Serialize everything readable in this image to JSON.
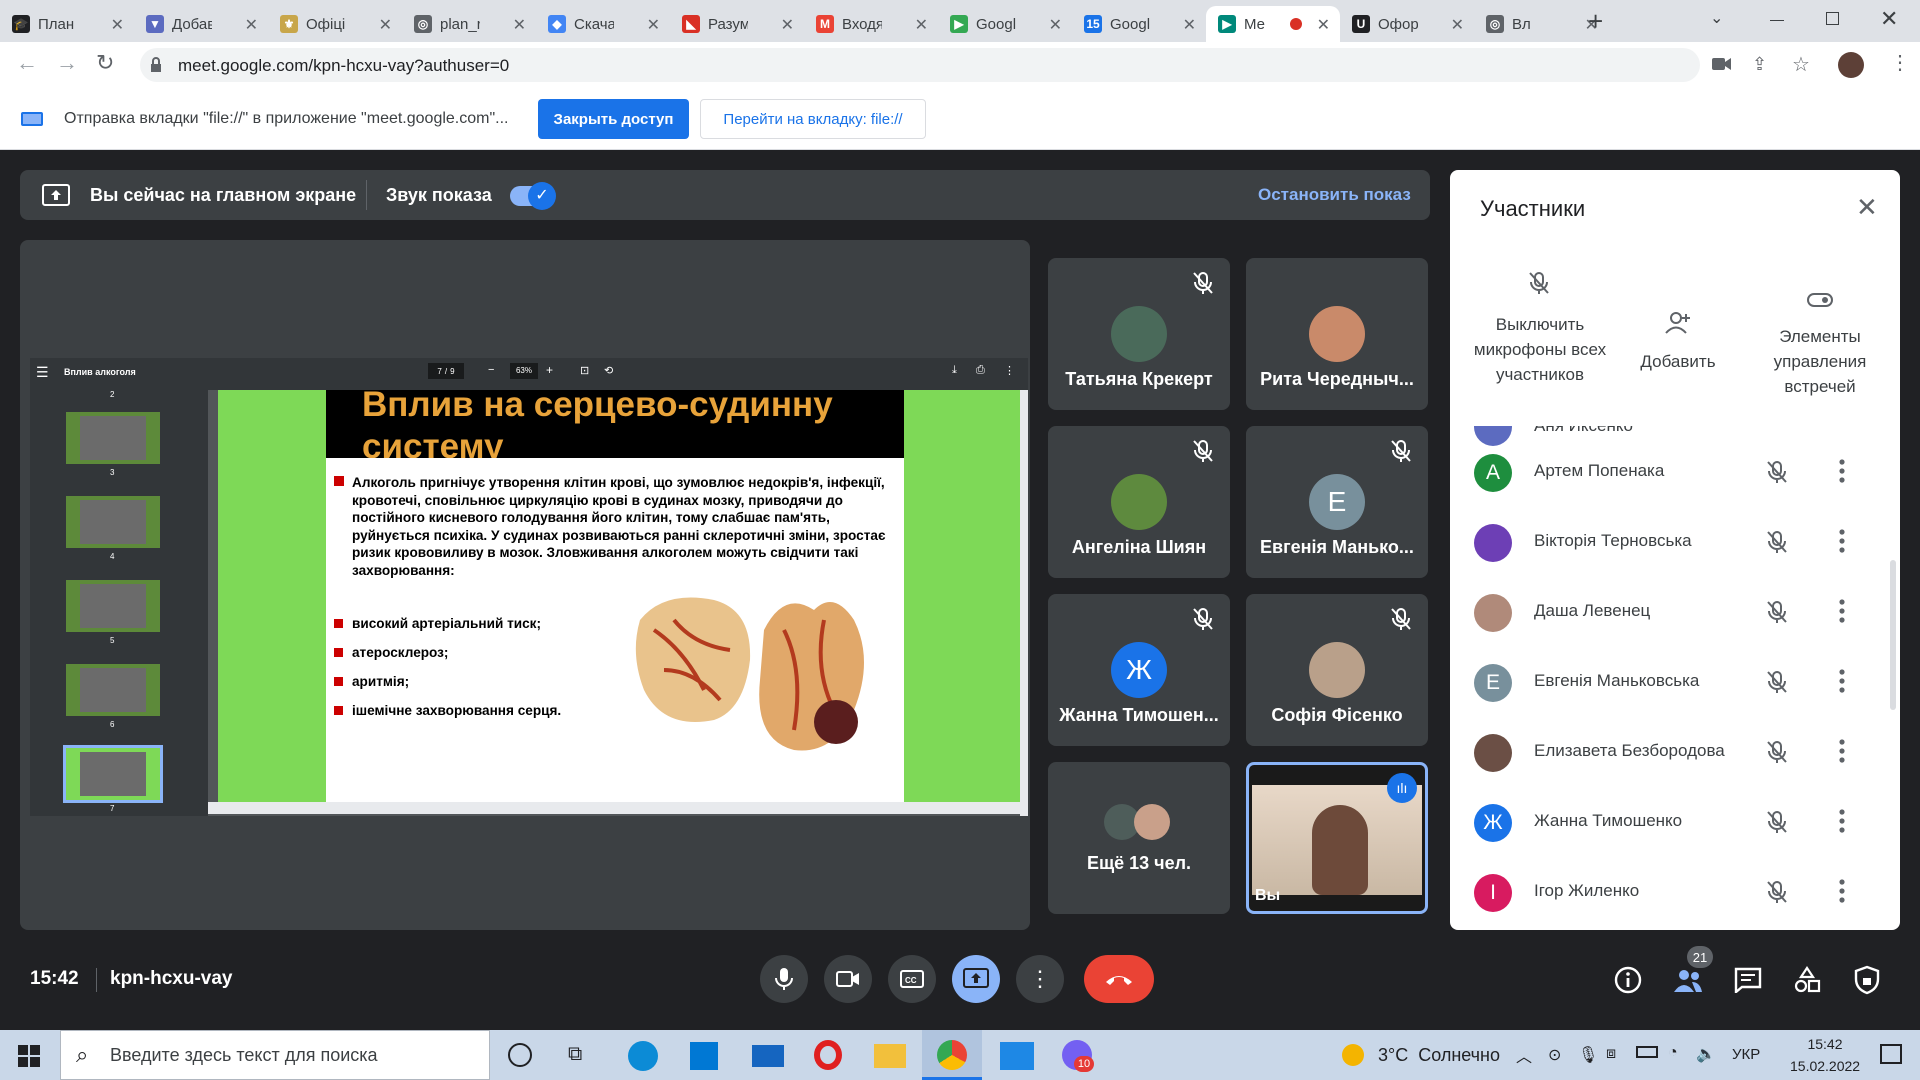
{
  "browser": {
    "tabs": [
      {
        "title": "План за",
        "fav": "#202124",
        "glyph": "🎓"
      },
      {
        "title": "Добавь",
        "fav": "#5c6bc0",
        "glyph": "▼"
      },
      {
        "title": "Офіційн",
        "fav": "#c8a64a",
        "glyph": "⚜"
      },
      {
        "title": "plan_ro",
        "fav": "#5f6368",
        "glyph": "◎"
      },
      {
        "title": "Скачать",
        "fav": "#4285f4",
        "glyph": "◆"
      },
      {
        "title": "Разум у",
        "fav": "#d93025",
        "glyph": "◣"
      },
      {
        "title": "Входящ",
        "fav": "#ea4335",
        "glyph": "M"
      },
      {
        "title": "Google",
        "fav": "#34a853",
        "glyph": "▶"
      },
      {
        "title": "Google",
        "fav": "#1a73e8",
        "glyph": "15"
      },
      {
        "title": "Ме",
        "fav": "#00897b",
        "glyph": "▶"
      },
      {
        "title": "Оформ",
        "fav": "#202124",
        "glyph": "U"
      },
      {
        "title": "Вл",
        "fav": "#5f6368",
        "glyph": "◎"
      }
    ],
    "url": "meet.google.com/kpn-hcxu-vay?authuser=0",
    "infobar_text": "Отправка вкладки \"file://\" в приложение \"meet.google.com\"...",
    "stop_access": "Закрыть доступ",
    "go_to_tab": "Перейти на вкладку: file://"
  },
  "share": {
    "status": "Вы сейчас на главном экране",
    "sound": "Звук показа",
    "stop": "Остановить показ"
  },
  "pdf": {
    "title": "Вплив алкоголя",
    "page": "7",
    "pages": "9",
    "zoom": "63%",
    "thumb_numbers": [
      "2",
      "3",
      "4",
      "5",
      "6",
      "7"
    ],
    "slide_title_1": "Вплив на серцево-судинну",
    "slide_title_2": "систему",
    "slide_paragraph": "Алкоголь пригнічує утворення клітин крові, що зумовлює недокрів'я, інфекції, кровотечі, сповільнює циркуляцію крові в судинах мозку, приводячи до постійного кисневого голодування його клітин, тому слабшає пам'ять, руйнується психіка. У судинах розвиваються ранні склеротичні зміни, зростає ризик крововиливу в мозок.  Зловживання алкоголем можуть свідчити такі захворювання:",
    "bullets": [
      "високий артеріальний тиск;",
      "атеросклероз;",
      "аритмія;",
      "ішемічне захворювання серця."
    ]
  },
  "tiles": [
    {
      "name": "Татьяна Крекерт",
      "muted": true
    },
    {
      "name": "Рита Чередныч...",
      "muted": false
    },
    {
      "name": "Ангеліна Шиян",
      "muted": true
    },
    {
      "name": "Евгенія Манько...",
      "muted": true,
      "letter": "Е"
    },
    {
      "name": "Жанна Тимошен...",
      "muted": true,
      "letter": "Ж"
    },
    {
      "name": "Софія Фісенко",
      "muted": true
    },
    {
      "name": "Ещё 13 чел."
    },
    {
      "name": "Вы"
    }
  ],
  "panel": {
    "title": "Участники",
    "actions": [
      "Выключить микрофоны всех участников",
      "Добавить",
      "Элементы управления встречей"
    ],
    "partial_top": "Аня Иксенко",
    "participants": [
      {
        "name": "Артем Попенака",
        "letter": "А",
        "color": "#1e8e3e"
      },
      {
        "name": "Вікторія Терновська",
        "letter": "",
        "color": "#6d3fb5"
      },
      {
        "name": "Даша Левенец",
        "letter": "",
        "color": "#b08a7a"
      },
      {
        "name": "Евгенія Маньковська",
        "letter": "Е",
        "color": "#78909c"
      },
      {
        "name": "Елизавета Безбородова",
        "letter": "",
        "color": "#6b4f45"
      },
      {
        "name": "Жанна Тимошенко",
        "letter": "Ж",
        "color": "#1a73e8"
      },
      {
        "name": "Ігор Жиленко",
        "letter": "І",
        "color": "#d81b60"
      }
    ]
  },
  "meeting": {
    "time": "15:42",
    "code": "kpn-hcxu-vay",
    "people_count": "21"
  },
  "taskbar": {
    "search_placeholder": "Введите здесь текст для поиска",
    "weather": "3°C  Солнечно",
    "lang": "УКР",
    "time": "15:42",
    "date": "15.02.2022",
    "viber_badge": "10"
  }
}
